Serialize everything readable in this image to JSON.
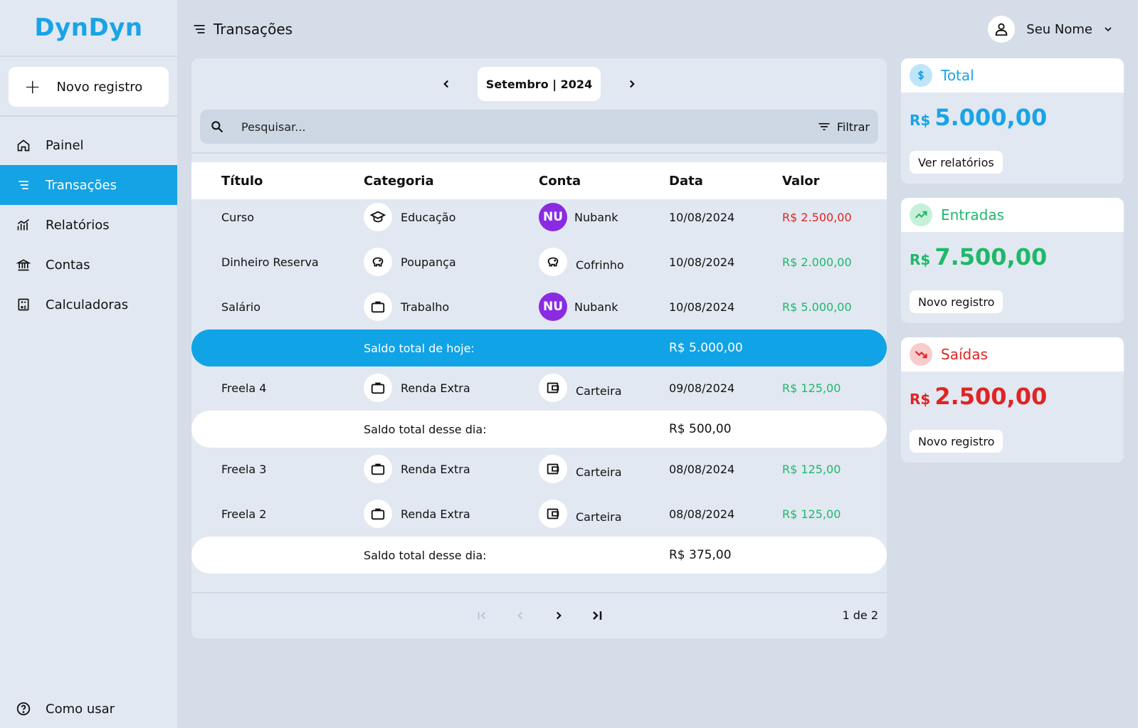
{
  "app": {
    "logo": "DynDyn"
  },
  "sidebar": {
    "new_button": "Novo registro",
    "items": [
      {
        "label": "Painel",
        "icon": "home-icon"
      },
      {
        "label": "Transações",
        "icon": "list-icon"
      },
      {
        "label": "Relatórios",
        "icon": "chart-icon"
      },
      {
        "label": "Contas",
        "icon": "bank-icon"
      },
      {
        "label": "Calculadoras",
        "icon": "calculator-icon"
      }
    ],
    "help": "Como usar"
  },
  "header": {
    "title": "Transações",
    "user_name": "Seu Nome"
  },
  "month_nav": {
    "label": "Setembro | 2024"
  },
  "search": {
    "placeholder": "Pesquisar...",
    "filter_label": "Filtrar"
  },
  "table": {
    "headers": {
      "title": "Título",
      "category": "Categoria",
      "account": "Conta",
      "date": "Data",
      "value": "Valor"
    },
    "rows": [
      {
        "title": "Curso",
        "category": "Educação",
        "category_icon": "graduation-cap-icon",
        "account": "Nubank",
        "account_badge": "NU",
        "date": "10/08/2024",
        "value": "R$ 2.500,00",
        "kind": "negative"
      },
      {
        "title": "Dinheiro Reserva",
        "category": "Poupança",
        "category_icon": "piggy-bank-icon",
        "account": "Cofrinho",
        "account_icon": "piggy-bank-icon",
        "date": "10/08/2024",
        "value": "R$ 2.000,00",
        "kind": "positive"
      },
      {
        "title": "Salário",
        "category": "Trabalho",
        "category_icon": "briefcase-icon",
        "account": "Nubank",
        "account_badge": "NU",
        "date": "10/08/2024",
        "value": "R$ 5.000,00",
        "kind": "positive"
      },
      {
        "title": "Freela 4",
        "category": "Renda Extra",
        "category_icon": "briefcase-icon",
        "account": "Carteira",
        "account_icon": "wallet-icon",
        "date": "09/08/2024",
        "value": "R$ 125,00",
        "kind": "positive"
      },
      {
        "title": "Freela 3",
        "category": "Renda Extra",
        "category_icon": "briefcase-icon",
        "account": "Carteira",
        "account_icon": "wallet-icon",
        "date": "08/08/2024",
        "value": "R$ 125,00",
        "kind": "positive"
      },
      {
        "title": "Freela 2",
        "category": "Renda Extra",
        "category_icon": "briefcase-icon",
        "account": "Carteira",
        "account_icon": "wallet-icon",
        "date": "08/08/2024",
        "value": "R$ 125,00",
        "kind": "positive"
      }
    ],
    "summaries": [
      {
        "label": "Saldo total de hoje:",
        "amount": "R$ 5.000,00"
      },
      {
        "label": "Saldo total desse dia:",
        "amount": "R$ 500,00"
      },
      {
        "label": "Saldo total desse dia:",
        "amount": "R$ 375,00"
      }
    ]
  },
  "pagination": {
    "label": "1 de 2"
  },
  "cards": {
    "total": {
      "title": "Total",
      "currency": "R$",
      "value": "5.000,00",
      "button": "Ver relatórios",
      "color": "#1aa3e6"
    },
    "income": {
      "title": "Entradas",
      "currency": "R$",
      "value": "7.500,00",
      "button": "Novo registro",
      "color": "#1fb86a"
    },
    "expense": {
      "title": "Saídas",
      "currency": "R$",
      "value": "2.500,00",
      "button": "Novo registro",
      "color": "#e02424"
    }
  }
}
